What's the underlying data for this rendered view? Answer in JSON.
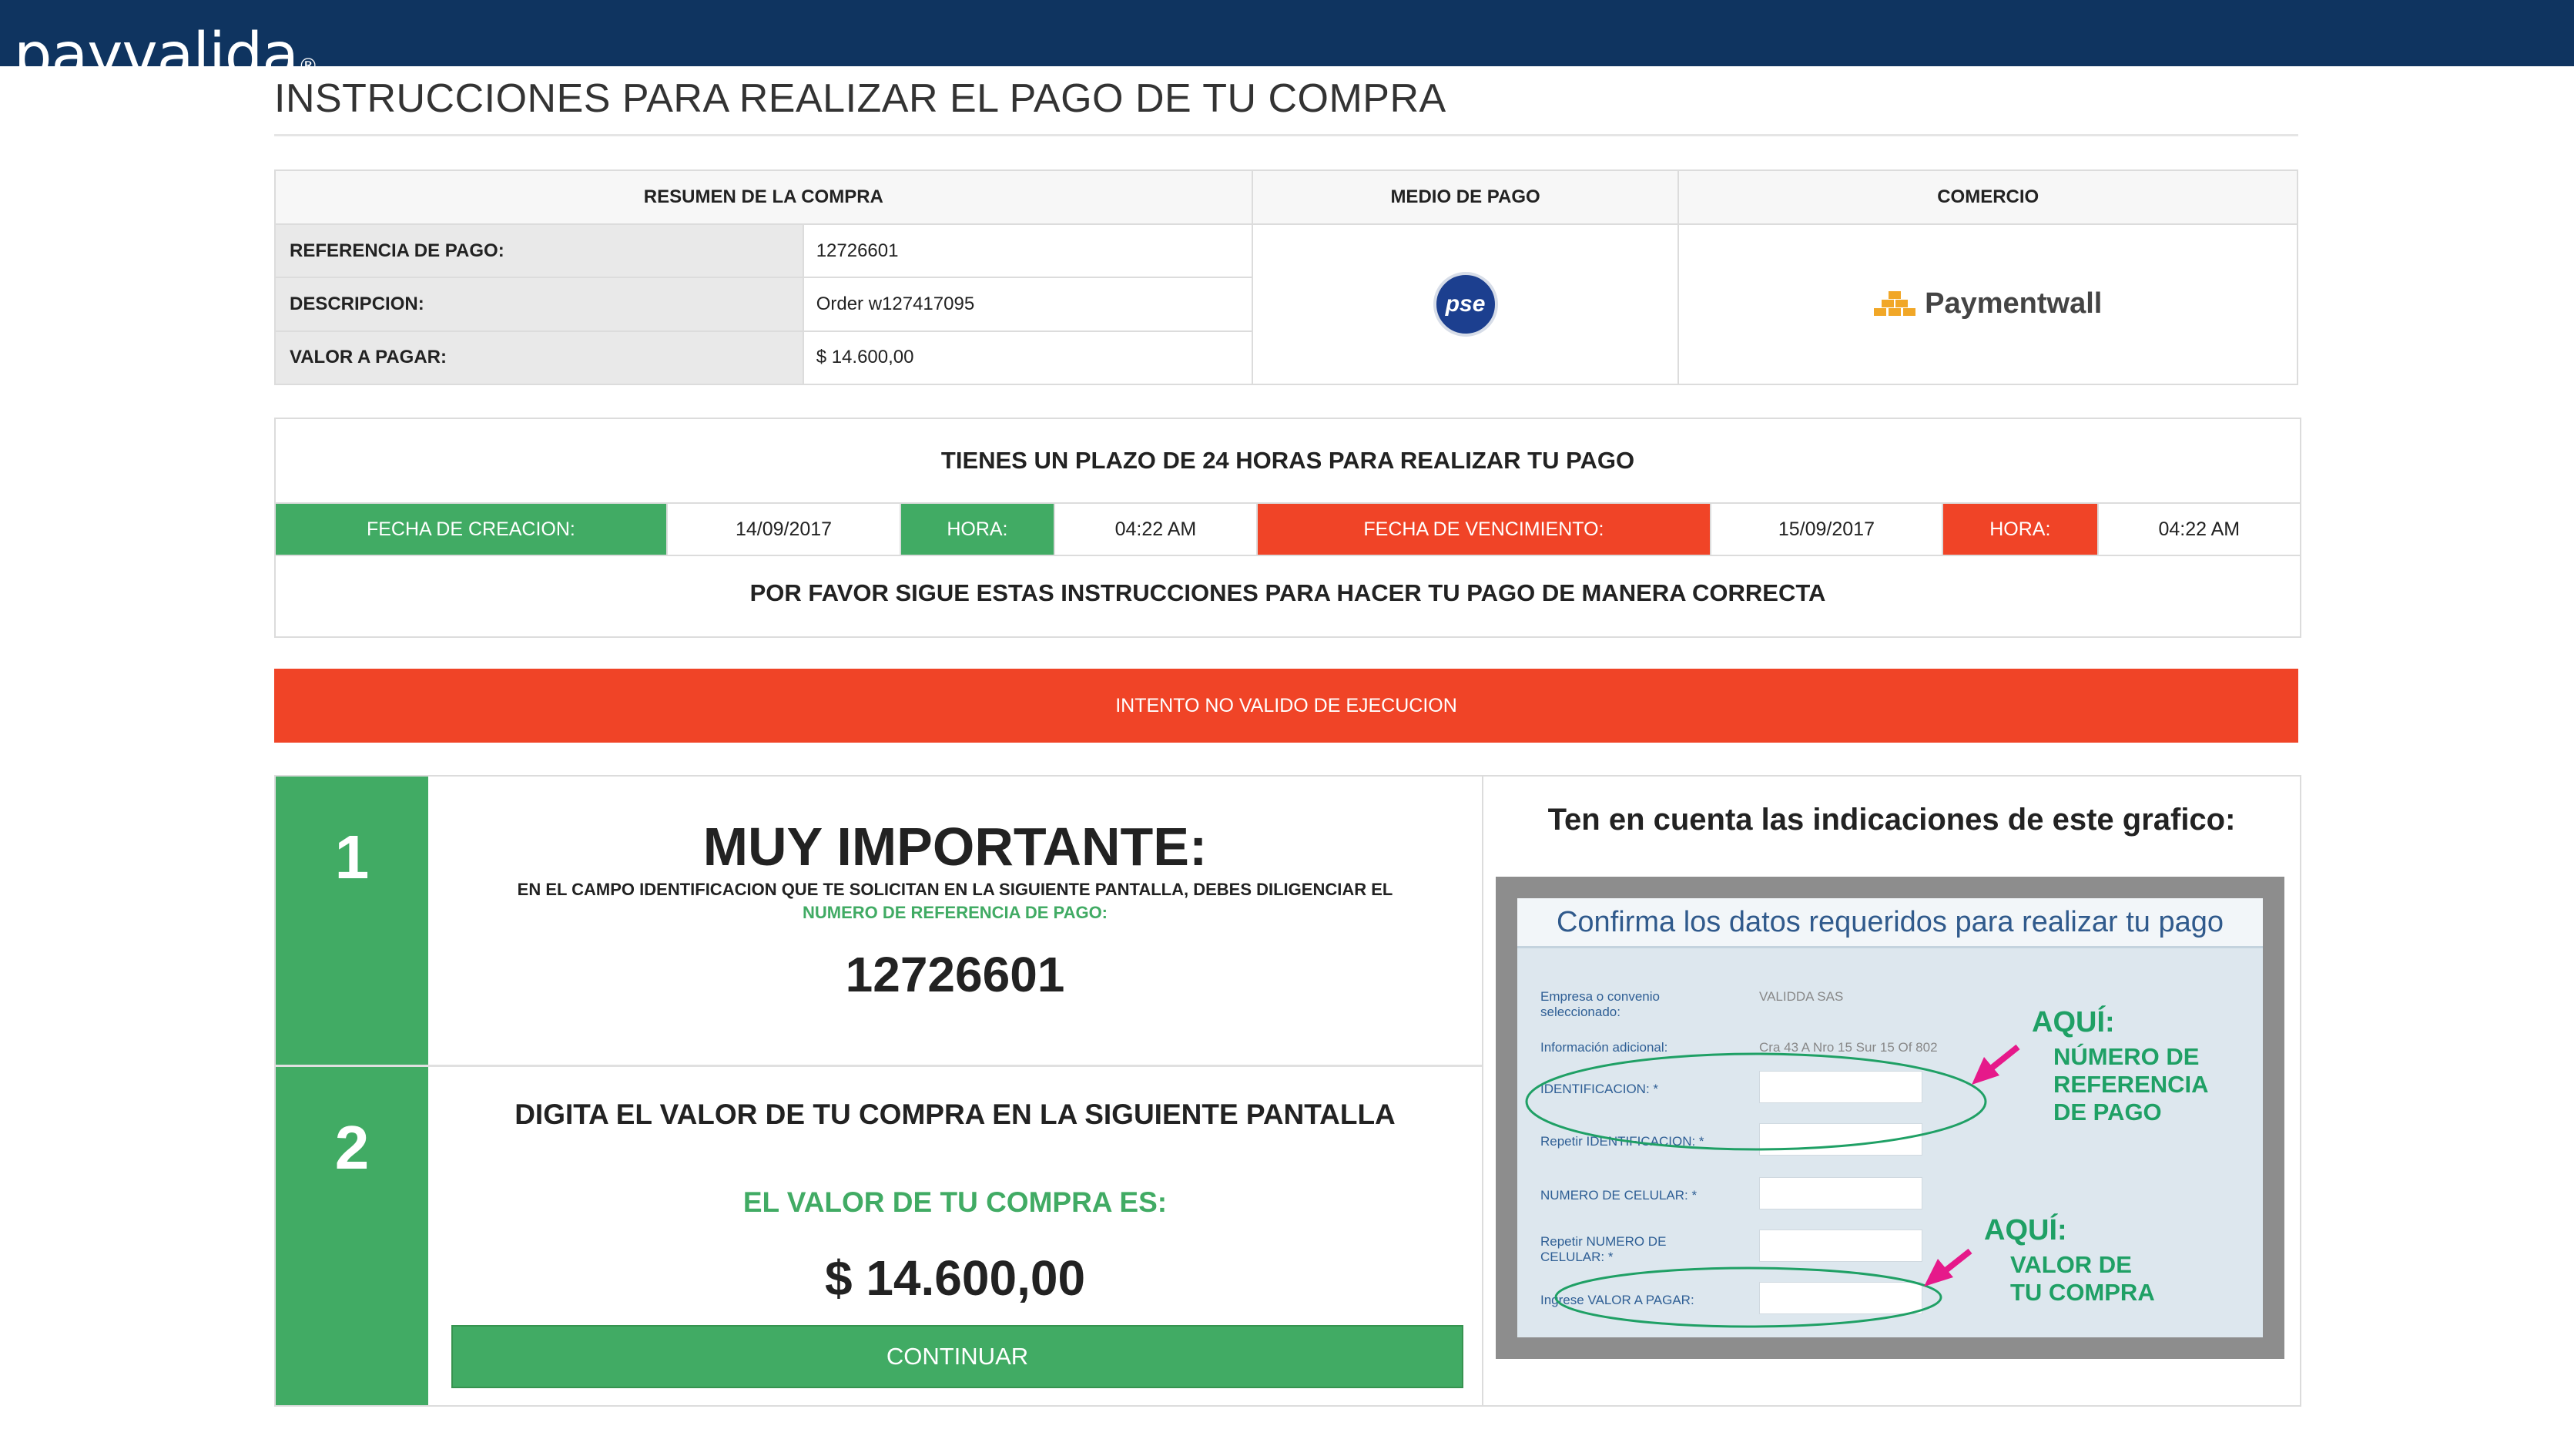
{
  "header": {
    "logo_text": "payvalida",
    "logo_mark": "®"
  },
  "page_title": "INSTRUCCIONES PARA REALIZAR EL PAGO DE TU COMPRA",
  "summary": {
    "col1": "RESUMEN DE LA COMPRA",
    "col2": "MEDIO DE PAGO",
    "col3": "COMERCIO",
    "rows": [
      {
        "label": "REFERENCIA DE PAGO:",
        "value": "12726601"
      },
      {
        "label": "DESCRIPCION:",
        "value": "Order w127417095"
      },
      {
        "label": "VALOR A PAGAR:",
        "value": "$ 14.600,00"
      }
    ],
    "payment_method": "pse",
    "merchant": "Paymentwall"
  },
  "deadline": {
    "heading": "TIENES UN PLAZO DE 24 HORAS PARA REALIZAR TU PAGO",
    "creation_label": "FECHA DE CREACION:",
    "creation_date": "14/09/2017",
    "hour_label": "HORA:",
    "creation_time": "04:22 AM",
    "expiry_label": "FECHA DE VENCIMIENTO:",
    "expiry_date": "15/09/2017",
    "expiry_time": "04:22 AM",
    "instructions": "POR FAVOR SIGUE ESTAS INSTRUCCIONES PARA HACER TU PAGO DE MANERA CORRECTA"
  },
  "error_banner": "INTENTO NO VALIDO DE EJECUCION",
  "step1": {
    "number": "1",
    "heading": "MUY IMPORTANTE:",
    "text": "EN EL CAMPO IDENTIFICACION QUE TE SOLICITAN EN LA SIGUIENTE PANTALLA, DEBES DILIGENCIAR EL",
    "highlight": "NUMERO DE REFERENCIA DE PAGO:",
    "reference": "12726601"
  },
  "step2": {
    "number": "2",
    "heading": "DIGITA EL VALOR DE TU COMPRA EN LA SIGUIENTE PANTALLA",
    "subheading": "EL VALOR DE TU COMPRA ES:",
    "amount": "$ 14.600,00",
    "button": "CONTINUAR"
  },
  "guide": {
    "title": "Ten en cuenta las indicaciones de este grafico:",
    "screen_title": "Confirma los datos requeridos para realizar tu pago",
    "company_label_1": "Empresa o convenio",
    "company_label_2": "seleccionado:",
    "company_value": "VALIDDA SAS",
    "info_label": "Información adicional:",
    "info_value": "Cra 43 A Nro 15 Sur 15 Of 802",
    "id_label": "IDENTIFICACION: *",
    "repeat_id_label": "Repetir IDENTIFICACION: *",
    "phone_label": "NUMERO DE CELULAR: *",
    "repeat_phone_label_1": "Repetir NUMERO DE",
    "repeat_phone_label_2": "CELULAR: *",
    "amount_label": "Ingrese VALOR A PAGAR:",
    "aqui_1": "AQUÍ:",
    "note_1a": "NÚMERO DE",
    "note_1b": "REFERENCIA",
    "note_1c": "DE PAGO",
    "aqui_2": "AQUÍ:",
    "note_2a": "VALOR DE",
    "note_2b": "TU COMPRA"
  }
}
